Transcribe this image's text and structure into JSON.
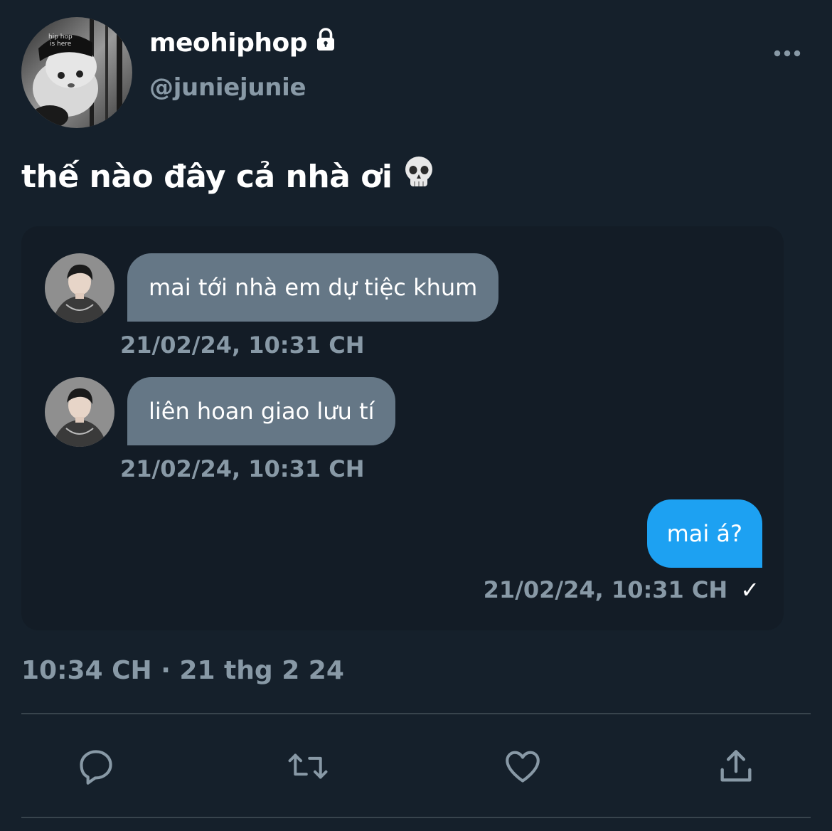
{
  "profile": {
    "display_name": "meohiphop",
    "handle": "@juniejunie",
    "avatar_icon": "cat-in-hiphop-hat-avatar",
    "locked_icon": "lock-icon"
  },
  "tweet": {
    "text": "thế nào đây cả nhà ơi",
    "emoji": "💀",
    "meta": "10:34 CH · 21 thg 2 24"
  },
  "chat": {
    "messages": [
      {
        "direction": "incoming",
        "text": "mai tới nhà em dự tiệc khum",
        "time": "21/02/24, 10:31 CH"
      },
      {
        "direction": "incoming",
        "text": "liên hoan giao lưu tí",
        "time": "21/02/24, 10:31 CH"
      },
      {
        "direction": "outgoing",
        "text": "mai á?",
        "time": "21/02/24, 10:31 CH",
        "status": "✓"
      }
    ]
  },
  "actions": [
    "reply-icon",
    "retweet-icon",
    "like-icon",
    "share-icon"
  ],
  "colors": {
    "background": "#15202b",
    "incoming_bubble": "#657786",
    "outgoing_bubble": "#1da1f2",
    "muted_text": "#8899a6"
  }
}
